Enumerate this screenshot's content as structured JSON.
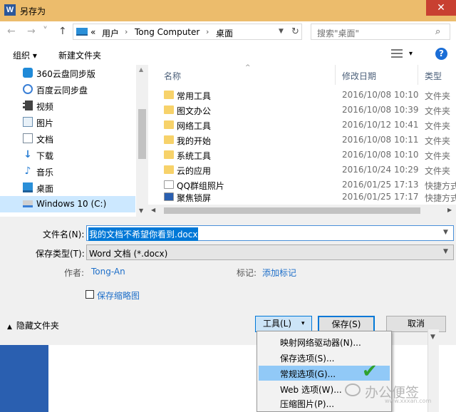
{
  "window": {
    "title": "另存为",
    "app_icon": "W",
    "close": "✕"
  },
  "nav": {
    "back": "←",
    "forward": "→",
    "up": "↑",
    "breadcrumb": [
      "«",
      "用户",
      "Tong Computer",
      "桌面"
    ],
    "separator": "›",
    "search_placeholder": "搜索\"桌面\""
  },
  "commands": {
    "organize": "组织 ▾",
    "new_folder": "新建文件夹",
    "view_dropdown": "▾",
    "help": "?"
  },
  "sidebar": {
    "items": [
      {
        "label": "360云盘同步版",
        "icon": "cloud-icon"
      },
      {
        "label": "百度云同步盘",
        "icon": "baidu-cloud-icon"
      },
      {
        "label": "视频",
        "icon": "video-icon"
      },
      {
        "label": "图片",
        "icon": "picture-icon"
      },
      {
        "label": "文档",
        "icon": "document-icon"
      },
      {
        "label": "下载",
        "icon": "download-icon"
      },
      {
        "label": "音乐",
        "icon": "music-icon"
      },
      {
        "label": "桌面",
        "icon": "desktop-icon"
      },
      {
        "label": "Windows 10 (C:)",
        "icon": "drive-icon",
        "selected": true
      }
    ]
  },
  "files": {
    "columns": {
      "name": "名称",
      "date": "修改日期",
      "type": "类型"
    },
    "rows": [
      {
        "name": "常用工具",
        "date": "2016/10/08 10:10",
        "type": "文件夹",
        "icon": "folder-icon"
      },
      {
        "name": "图文办公",
        "date": "2016/10/08 10:39",
        "type": "文件夹",
        "icon": "folder-icon"
      },
      {
        "name": "网络工具",
        "date": "2016/10/12 10:41",
        "type": "文件夹",
        "icon": "folder-icon"
      },
      {
        "name": "我的开始",
        "date": "2016/10/08 10:11",
        "type": "文件夹",
        "icon": "folder-icon"
      },
      {
        "name": "系统工具",
        "date": "2016/10/08 10:10",
        "type": "文件夹",
        "icon": "folder-icon"
      },
      {
        "name": "云的应用",
        "date": "2016/10/24 10:29",
        "type": "文件夹",
        "icon": "folder-icon"
      },
      {
        "name": "QQ群组照片",
        "date": "2016/01/25 17:13",
        "type": "快捷方式",
        "icon": "shortcut-icon"
      },
      {
        "name": "聚焦锁屏",
        "date": "2016/01/25 17:17",
        "type": "快捷方式",
        "icon": "shortcut-icon"
      }
    ]
  },
  "form": {
    "filename_label": "文件名(N):",
    "filename_value": "我的文档不希望你看到.docx",
    "filetype_label": "保存类型(T):",
    "filetype_value": "Word 文档 (*.docx)",
    "author_label": "作者:",
    "author_value": "Tong-An",
    "tags_label": "标记:",
    "tags_value": "添加标记",
    "thumbnail_label": "保存缩略图"
  },
  "footer": {
    "hide_folders": "隐藏文件夹",
    "tools_label": "工具(L)",
    "tools_dd": "▾",
    "save_label": "保存(S)",
    "cancel_label": "取消"
  },
  "tools_menu": {
    "items": [
      {
        "label": "映射网络驱动器(N)...",
        "highlighted": false
      },
      {
        "label": "保存选项(S)...",
        "highlighted": false
      },
      {
        "label": "常规选项(G)...",
        "highlighted": true
      },
      {
        "label": "Web 选项(W)...",
        "highlighted": false
      },
      {
        "label": "压缩图片(P)...",
        "highlighted": false
      }
    ]
  },
  "overlay": {
    "checkmark": "✔",
    "watermark": "办公便签",
    "watermark_url": "www.xxxan.com"
  }
}
